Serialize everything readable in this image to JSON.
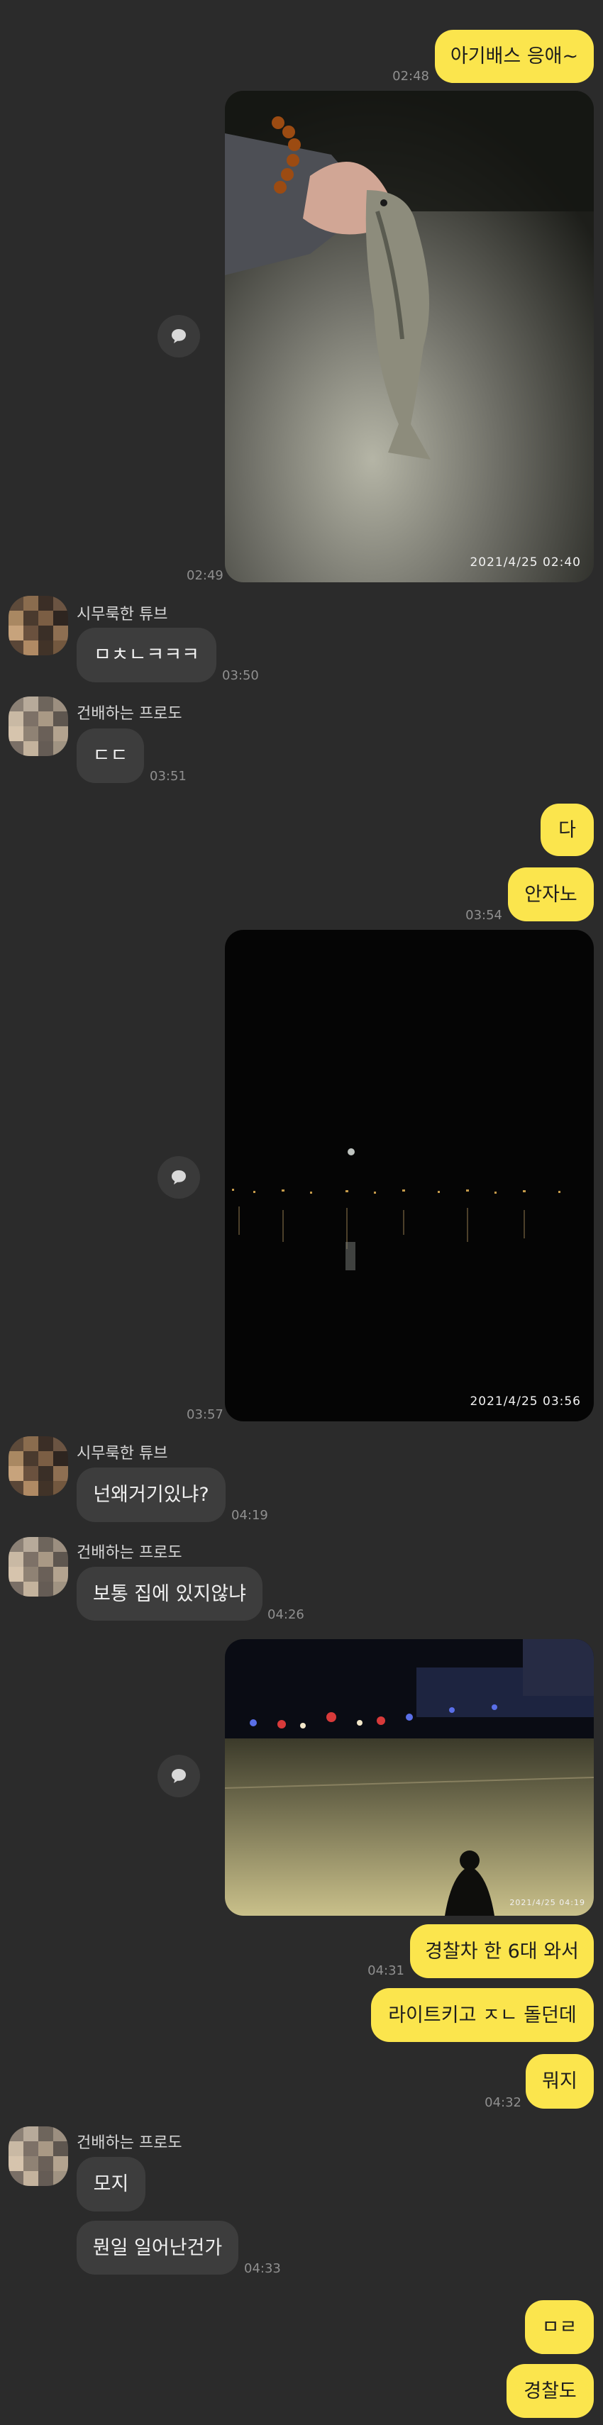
{
  "messages": {
    "m1": {
      "text": "아기배스 응애~",
      "time": "02:48"
    },
    "photo1": {
      "stamp": "2021/4/25  02:40",
      "time": "02:49"
    },
    "g1": {
      "name": "시무룩한 튜브",
      "text": "ㅁㅊㄴㅋㅋㅋ",
      "time": "03:50"
    },
    "g2": {
      "name": "건배하는 프로도",
      "text": "ㄷㄷ",
      "time": "03:51"
    },
    "m2": {
      "text": "다"
    },
    "m3": {
      "text": "안자노",
      "time": "03:54"
    },
    "photo2": {
      "stamp": "2021/4/25  03:56",
      "time": "03:57"
    },
    "g3": {
      "name": "시무룩한 튜브",
      "text": "넌왜거기있냐?",
      "time": "04:19"
    },
    "g4": {
      "name": "건배하는 프로도",
      "text": "보통 집에 있지않냐",
      "time": "04:26"
    },
    "photo3": {
      "stamp": "2021/4/25  04:19"
    },
    "m4": {
      "text": "경찰차 한 6대 와서",
      "time": "04:31"
    },
    "m5": {
      "text": "라이트키고 ㅈㄴ 돌던데"
    },
    "m6": {
      "text": "뭐지",
      "time": "04:32"
    },
    "g5": {
      "name": "건배하는 프로도",
      "text": "모지"
    },
    "g6": {
      "text": "뭔일 일어난건가",
      "time": "04:33"
    },
    "m7": {
      "text": "ㅁㄹ"
    },
    "m8": {
      "text": "경찰도"
    }
  },
  "icons": {
    "share": "share-speech-bubble-icon",
    "avatar": "pixelated-avatar"
  },
  "colors": {
    "background": "#2b2b2b",
    "my_bubble": "#fbe54d",
    "other_bubble": "#3d3d3d",
    "timestamp": "#8f8f8f"
  }
}
